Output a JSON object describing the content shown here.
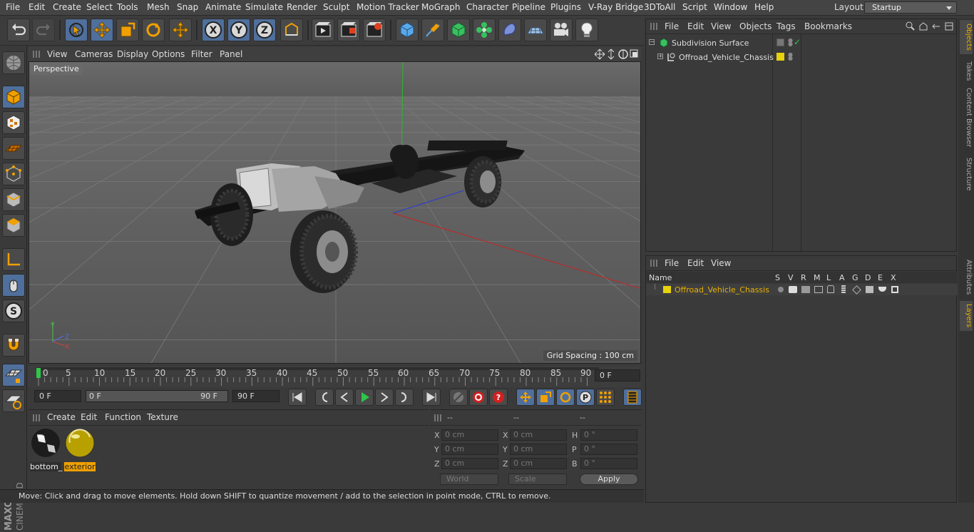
{
  "menubar": {
    "items": [
      "File",
      "Edit",
      "Create",
      "Select",
      "Tools",
      "Mesh",
      "Snap",
      "Animate",
      "Simulate",
      "Render",
      "Sculpt",
      "Motion Tracker",
      "MoGraph",
      "Character",
      "Pipeline",
      "Plugins",
      "V-Ray Bridge",
      "3DToAll",
      "Script",
      "Window",
      "Help"
    ],
    "layout_label": "Layout:",
    "layout_value": "Startup"
  },
  "toolbar": {
    "icons": [
      "undo-icon",
      "redo-icon",
      "live-selection-icon",
      "move-icon",
      "scale-icon",
      "rotate-icon",
      "last-tool-icon",
      "x-axis-icon",
      "y-axis-icon",
      "z-axis-icon",
      "coordinate-system-icon",
      "render-view-icon",
      "render-picture-viewer-icon",
      "render-settings-icon",
      "cube-icon",
      "pen-icon",
      "subdivision-icon",
      "cloner-icon",
      "deformer-icon",
      "floor-icon",
      "camera-icon",
      "light-icon"
    ],
    "axis_x": "X",
    "axis_y": "Y",
    "axis_z": "Z"
  },
  "left_tools": {
    "icons": [
      "make-editable-icon",
      "model-mode-icon",
      "texture-mode-icon",
      "workplane-icon",
      "points-mode-icon",
      "edges-mode-icon",
      "polygons-mode-icon",
      "axis-mode-icon",
      "tweak-mode-icon",
      "solo-icon",
      "magnet-icon",
      "snap-icon",
      "locked-workplane-icon"
    ],
    "solo_label": "S"
  },
  "viewport": {
    "menu": [
      "View",
      "Cameras",
      "Display",
      "Options",
      "Filter",
      "Panel"
    ],
    "label": "Perspective",
    "grid_spacing": "Grid Spacing : 100 cm"
  },
  "timeline": {
    "ticks": [
      "0",
      "5",
      "10",
      "15",
      "20",
      "25",
      "30",
      "35",
      "40",
      "45",
      "50",
      "55",
      "60",
      "65",
      "70",
      "75",
      "80",
      "85",
      "90"
    ],
    "current_frame": "0 F"
  },
  "transport": {
    "start": "0 F",
    "range_start": "0 F",
    "range_end": "90 F",
    "end": "90 F"
  },
  "materials": {
    "menu": [
      "Create",
      "Edit",
      "Function",
      "Texture"
    ],
    "items": [
      {
        "name": "bottom_",
        "selected": false
      },
      {
        "name": "exterior",
        "selected": true
      }
    ]
  },
  "coords": {
    "headers": [
      "--",
      "--",
      "--"
    ],
    "rows": [
      {
        "a": "X",
        "av": "0 cm",
        "b": "X",
        "bv": "0 cm",
        "c": "H",
        "cv": "0 °"
      },
      {
        "a": "Y",
        "av": "0 cm",
        "b": "Y",
        "bv": "0 cm",
        "c": "P",
        "cv": "0 °"
      },
      {
        "a": "Z",
        "av": "0 cm",
        "b": "Z",
        "bv": "0 cm",
        "c": "B",
        "cv": "0 °"
      }
    ],
    "world": "World",
    "scale": "Scale",
    "apply": "Apply"
  },
  "status": "Move: Click and drag to move elements. Hold down SHIFT to quantize movement / add to the selection in point mode, CTRL to remove.",
  "objects_panel": {
    "menu": [
      "File",
      "Edit",
      "View",
      "Objects",
      "Tags",
      "Bookmarks"
    ],
    "tree": [
      {
        "name": "Subdivision Surface"
      },
      {
        "name": "Offroad_Vehicle_Chassis"
      }
    ]
  },
  "layers_panel": {
    "menu": [
      "File",
      "Edit",
      "View"
    ],
    "columns": [
      "Name",
      "S",
      "V",
      "R",
      "M",
      "L",
      "A",
      "G",
      "D",
      "E",
      "X"
    ],
    "rows": [
      {
        "name": "Offroad_Vehicle_Chassis",
        "color": "#e8d20c"
      }
    ]
  },
  "right_tabs": [
    "Objects",
    "Takes",
    "Content Browser",
    "Structure",
    "Attributes",
    "Layers"
  ],
  "colors": {
    "accent": "#e8b000",
    "selection": "#4f6f9c",
    "layer_yellow": "#e8d20c"
  }
}
